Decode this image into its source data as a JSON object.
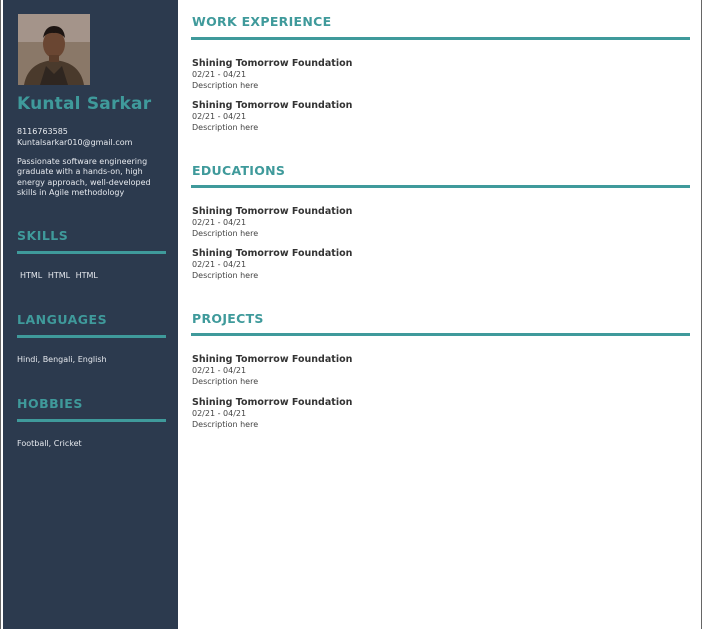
{
  "profile": {
    "name": "Kuntal Sarkar",
    "phone": "8116763585",
    "email": "Kuntalsarkar010@gmail.com",
    "summary": "Passionate software engineering graduate with a hands-on, high energy approach, well-developed skills in Agile methodology",
    "photo_icon": "profile-photo"
  },
  "sidebar": {
    "skills_heading": "SKILLS",
    "skills": [
      "HTML",
      "HTML",
      "HTML"
    ],
    "languages_heading": "LANGUAGES",
    "languages": "Hindi, Bengali, English",
    "hobbies_heading": "HOBBIES",
    "hobbies": "Football, Cricket"
  },
  "sections": [
    {
      "heading": "WORK EXPERIENCE",
      "entries": [
        {
          "org": "Shining Tomorrow Foundation",
          "date": "02/21 - 04/21",
          "desc": "Description here"
        },
        {
          "org": "Shining Tomorrow Foundation",
          "date": "02/21 - 04/21",
          "desc": "Description here"
        }
      ]
    },
    {
      "heading": "EDUCATIONS",
      "entries": [
        {
          "org": "Shining Tomorrow Foundation",
          "date": "02/21 - 04/21",
          "desc": "Description here"
        },
        {
          "org": "Shining Tomorrow Foundation",
          "date": "02/21 - 04/21",
          "desc": "Description here"
        }
      ]
    },
    {
      "heading": "PROJECTS",
      "entries": [
        {
          "org": "Shining Tomorrow Foundation",
          "date": "02/21 - 04/21",
          "desc": "Description here"
        },
        {
          "org": "Shining Tomorrow Foundation",
          "date": "02/21 - 04/21",
          "desc": "Description here"
        }
      ]
    }
  ],
  "colors": {
    "sidebar": "#2c3a4e",
    "accent": "#3f9a9b"
  }
}
